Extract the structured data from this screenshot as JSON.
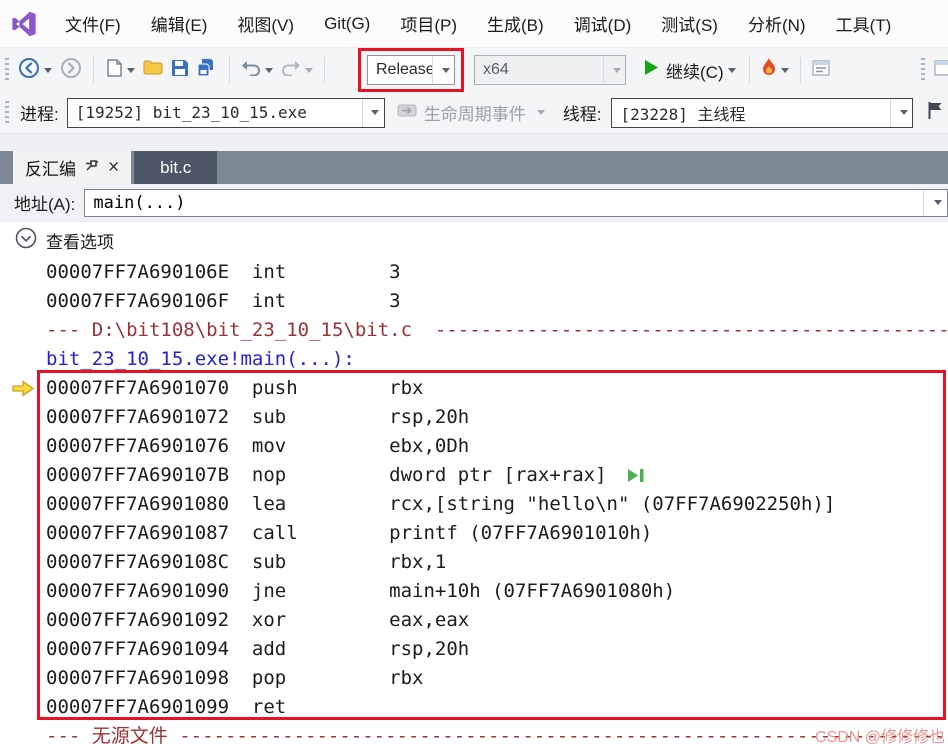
{
  "menu": {
    "items": [
      "文件(F)",
      "编辑(E)",
      "视图(V)",
      "Git(G)",
      "项目(P)",
      "生成(B)",
      "调试(D)",
      "测试(S)",
      "分析(N)",
      "工具(T)"
    ]
  },
  "toolbar": {
    "configuration": "Release",
    "platform": "x64",
    "continue_label": "继续(C)"
  },
  "debug_bar": {
    "process_label": "进程:",
    "process_value": "[19252] bit_23_10_15.exe",
    "lifecycle_label": "生命周期事件",
    "thread_label": "线程:",
    "thread_value": "[23228] 主线程"
  },
  "tabs": [
    {
      "label": "反汇编",
      "close_glyph": "×"
    },
    {
      "label": "bit.c"
    }
  ],
  "address_bar": {
    "label": "地址(A):",
    "value": "main(...)"
  },
  "viewing_options_label": "查看选项",
  "disassembly": {
    "lines": [
      {
        "type": "asm",
        "text": "00007FF7A690106E  int         3"
      },
      {
        "type": "asm",
        "text": "00007FF7A690106F  int         3"
      },
      {
        "type": "path",
        "text": "--- D:\\bit108\\bit_23_10_15\\bit.c  -----------------------------------------------------------------------"
      },
      {
        "type": "symbol",
        "text": "bit_23_10_15.exe!main(...):"
      },
      {
        "type": "asm",
        "current": true,
        "text": "00007FF7A6901070  push        rbx"
      },
      {
        "type": "asm",
        "text": "00007FF7A6901072  sub         rsp,20h"
      },
      {
        "type": "asm",
        "text": "00007FF7A6901076  mov         ebx,0Dh"
      },
      {
        "type": "asm",
        "marker": true,
        "text": "00007FF7A690107B  nop         dword ptr [rax+rax]"
      },
      {
        "type": "asm",
        "text": "00007FF7A6901080  lea         rcx,[string \"hello\\n\" (07FF7A6902250h)]"
      },
      {
        "type": "asm",
        "text": "00007FF7A6901087  call        printf (07FF7A6901010h)"
      },
      {
        "type": "asm",
        "text": "00007FF7A690108C  sub         rbx,1"
      },
      {
        "type": "asm",
        "text": "00007FF7A6901090  jne         main+10h (07FF7A6901080h)"
      },
      {
        "type": "asm",
        "text": "00007FF7A6901092  xor         eax,eax"
      },
      {
        "type": "asm",
        "text": "00007FF7A6901094  add         rsp,20h"
      },
      {
        "type": "asm",
        "text": "00007FF7A6901098  pop         rbx"
      },
      {
        "type": "asm",
        "text": "00007FF7A6901099  ret"
      },
      {
        "type": "path",
        "text": "--- 无源文件 ------------------------------------------------------------------------------------------"
      }
    ]
  },
  "watermark": "CSDN @修修修也",
  "icons": {
    "vs_logo": "vs-logo",
    "back": "navigate-back",
    "forward": "navigate-forward",
    "save": "floppy-disk",
    "open": "folder",
    "continue": "green-play-triangle",
    "hot_reload": "flame",
    "thread_flag": "flag",
    "current_instruction": "yellow-arrow",
    "run_to_here": "green-play-bar"
  },
  "colors": {
    "annotation": "#e81224",
    "current_line_arrow": "#ffd83b",
    "separator_text": "#9c3434",
    "symbol_text": "#2222d8",
    "step_marker": "#4caf50"
  }
}
